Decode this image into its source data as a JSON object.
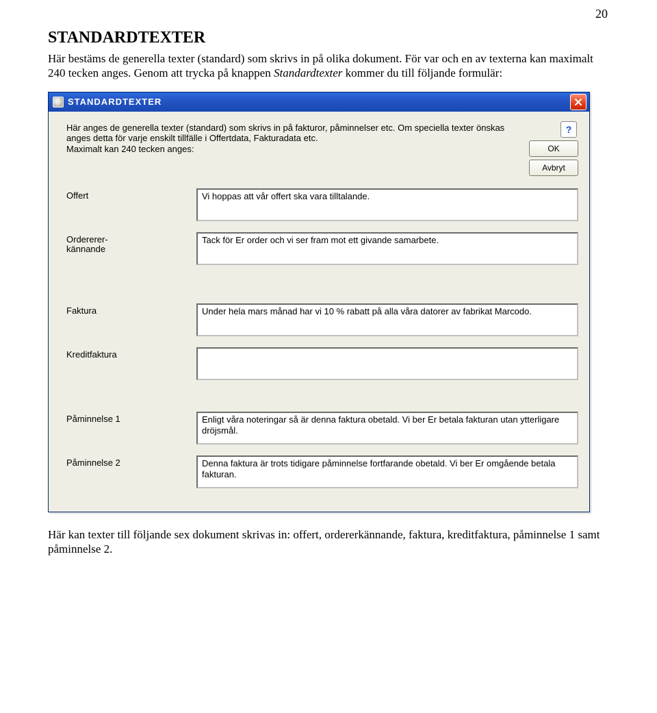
{
  "page_number": "20",
  "heading": "STANDARDTEXTER",
  "lead_part1": "Här bestäms de generella texter (standard) som skrivs in på olika dokument. För var och en av texterna kan maximalt 240 tecken anges. Genom att trycka på knappen ",
  "lead_italic": "Standardtexter",
  "lead_part2": " kommer du till följande formulär:",
  "window": {
    "title": "STANDARDTEXTER",
    "desc": "Här anges de generella texter (standard) som skrivs in på fakturor, påminnelser etc. Om speciella texter önskas anges detta för varje enskilt tillfälle i Offertdata, Fakturadata etc.\nMaximalt kan 240 tecken anges:",
    "help_symbol": "?",
    "ok_label": "OK",
    "cancel_label": "Avbryt",
    "fields": [
      {
        "label": "Offert",
        "value": "Vi hoppas att vår offert ska vara tilltalande."
      },
      {
        "label1": "Ordererer-",
        "label2": "kännande",
        "value": "Tack för Er order och vi ser fram mot ett givande samarbete."
      },
      {
        "label": "Faktura",
        "value": "Under hela mars månad har vi 10 % rabatt på alla våra datorer av fabrikat Marcodo."
      },
      {
        "label": "Kreditfaktura",
        "value": ""
      },
      {
        "label": "Påminnelse 1",
        "value": "Enligt våra noteringar så är denna faktura obetald. Vi ber Er betala fakturan utan ytterligare dröjsmål."
      },
      {
        "label": "Påminnelse 2",
        "value": "Denna faktura är trots tidigare påminnelse fortfarande obetald. Vi ber Er omgående betala fakturan."
      }
    ]
  },
  "outro": "Här kan texter till följande sex dokument skrivas in: offert, ordererkännande, faktura, kreditfaktura, påminnelse 1 samt påminnelse 2."
}
